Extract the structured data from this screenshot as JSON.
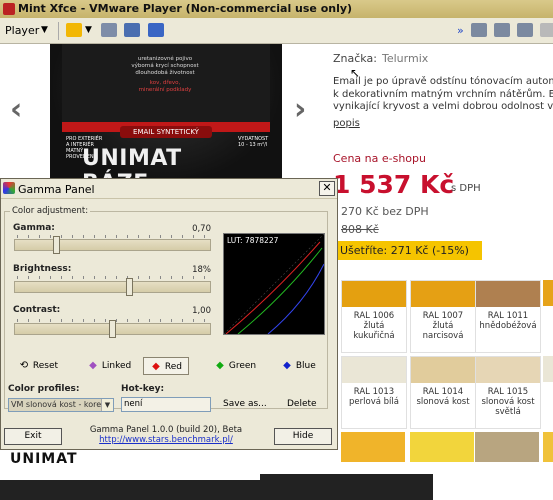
{
  "window": {
    "title": "Mint Xfce - VMware Player (Non-commercial use only)",
    "player_menu": "Player"
  },
  "page": {
    "product_label": {
      "lines": [
        "uretanizovné pojivo",
        "výborná krycí schopnost",
        "dlouhodobá životnost"
      ],
      "red_lines": [
        "kov, dřevo,",
        "minerální podklady"
      ],
      "email_badge": "EMAIL SYNTETICKÝ",
      "left_side": [
        "PRO EXTERIÉR",
        "A INTERIÉR",
        "MATNÝ",
        "PROVEDENÍ"
      ],
      "right_side": [
        "VYDATNOST",
        "10 - 13 m²/l"
      ],
      "brand_word": "UNIMAT BÁZE",
      "bottom_brand": "UNIMAT"
    },
    "brand_label": "Značka:",
    "brand_value": "Telurmix",
    "description_lines": [
      "Email je po úpravě odstínu tónovacím automa",
      "k dekorativním matným vrchním nátěrům. Em",
      "vynikající kryvost a velmi dobrou odolnost vůč"
    ],
    "description_link": "popis",
    "price_label": "Cena na e-shopu",
    "price": "1 537 Kč",
    "price_suffix": "s DPH",
    "price_without_vat": "270 Kč bez DPH",
    "old_price": "808 Kč",
    "savings": "Ušetříte: 271 Kč (-15%)",
    "swatches": [
      {
        "name": "RAL 1006\nžlutá\nkukuřičná",
        "color": "#e4a010"
      },
      {
        "name": "RAL 1007\nžlutá\nnarcisová",
        "color": "#e5a014"
      },
      {
        "name": "RAL 1011\nhnědobéžová",
        "color": "#af8050"
      },
      {
        "name": "RAL 1013\nperlová bílá",
        "color": "#eae6d6"
      },
      {
        "name": "RAL 1014\nslonová kost",
        "color": "#e1cc9c"
      },
      {
        "name": "RAL 1015\nslonová kost\nsvětlá",
        "color": "#e6d6b5"
      }
    ],
    "swatch_row3_colors": [
      "#f0b42a",
      "#f2d53c",
      "#b8a580"
    ],
    "swatch_edge_colors": [
      "#e6a31a",
      "#eae6d6",
      "#f0c23a"
    ]
  },
  "gamma": {
    "title": "Gamma Panel",
    "close": "✕",
    "group_label": "Color adjustment:",
    "gamma_label": "Gamma:",
    "gamma_value": "0,70",
    "gamma_level": 0.2,
    "brightness_label": "Brightness:",
    "brightness_value": "18%",
    "brightness_level": 0.59,
    "contrast_label": "Contrast:",
    "contrast_value": "1,00",
    "contrast_level": 0.5,
    "lut_label": "LUT: 7878227",
    "reset": "Reset",
    "linked": "Linked",
    "red": "Red",
    "green": "Green",
    "blue": "Blue",
    "profiles_label": "Color profiles:",
    "profile_selected": "VM slonová kost - korek",
    "hotkey_label": "Hot-key:",
    "hotkey_value": "není",
    "save_as": "Save as...",
    "delete": "Delete",
    "exit": "Exit",
    "hide": "Hide",
    "version": "Gamma Panel 1.0.0 (build 20), Beta",
    "url": "http://www.stars.benchmark.pl/",
    "colors": {
      "red": "#d11",
      "green": "#1a1",
      "blue": "#12c"
    }
  }
}
